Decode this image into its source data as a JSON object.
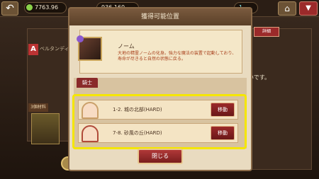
{
  "header": {
    "stamina": "7763.96",
    "gold": "936,160",
    "gems": "1"
  },
  "background": {
    "rank": "A",
    "char_name": "ベルタンディー",
    "sub_label": "3個材料",
    "tab_label": "詳細",
    "right_text": "ないです。"
  },
  "modal": {
    "title": "獲得可能位置",
    "item_name": "ノーム",
    "item_desc": "大地の精霊ノームの化身。強力な魔法の装置で起動しており、寿命が尽きると自然の状態に戻る。",
    "tab_label": "騎士",
    "rows": [
      {
        "label": "1-2. 城の北部(HARD)",
        "button": "移動"
      },
      {
        "label": "7-8. 砂風の丘(HARD)",
        "button": "移動"
      }
    ],
    "close_label": "閉じる"
  }
}
